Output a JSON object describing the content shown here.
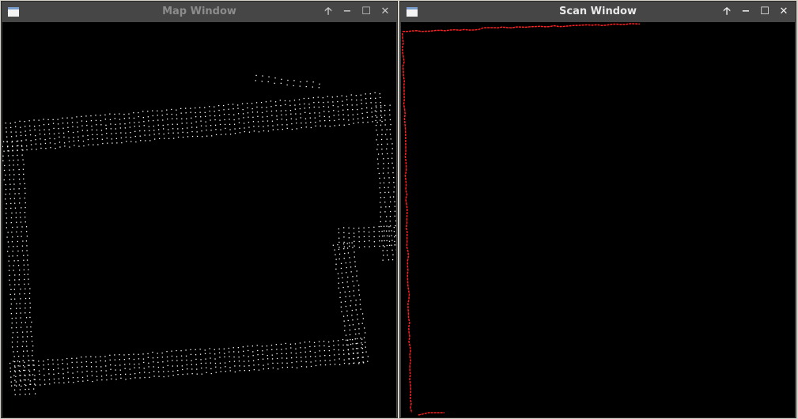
{
  "windows": [
    {
      "title": "Map Window",
      "buttons": {
        "raise": "🡡",
        "minimize": "−",
        "maximize": "☐",
        "close": "✕"
      }
    },
    {
      "title": "Scan Window",
      "buttons": {
        "raise": "🡡",
        "minimize": "−",
        "maximize": "☐",
        "close": "✕"
      }
    }
  ],
  "colors": {
    "map_points": "#ffffff",
    "scan_points": "#ff2020",
    "background": "#000000"
  }
}
